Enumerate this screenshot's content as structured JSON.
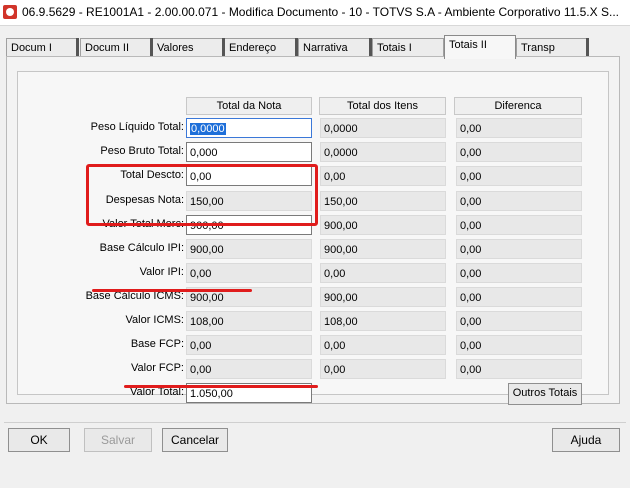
{
  "window": {
    "title": "06.9.5629 - RE1001A1 - 2.00.00.071 - Modifica Documento - 10 - TOTVS S.A - Ambiente Corporativo 11.5.X S..."
  },
  "tabs": [
    {
      "label": "Docum I"
    },
    {
      "label": "Docum II"
    },
    {
      "label": "Valores"
    },
    {
      "label": "Endereço"
    },
    {
      "label": "Narrativa"
    },
    {
      "label": "Totais I"
    },
    {
      "label": "Totais II"
    },
    {
      "label": "Transp"
    }
  ],
  "active_tab": "Totais II",
  "columns": [
    "Total da Nota",
    "Total dos Itens",
    "Diferenca"
  ],
  "rows": [
    {
      "label": "Peso Líquido Total:",
      "nota": "0,0000",
      "itens": "0,0000",
      "dif": "0,00"
    },
    {
      "label": "Peso Bruto Total:",
      "nota": "0,000",
      "itens": "0,0000",
      "dif": "0,00"
    },
    {
      "label": "Total Descto:",
      "nota": "0,00",
      "itens": "0,00",
      "dif": "0,00"
    },
    {
      "label": "Despesas Nota:",
      "nota": "150,00",
      "itens": "150,00",
      "dif": "0,00"
    },
    {
      "label": "Valor Total Merc:",
      "nota": "900,00",
      "itens": "900,00",
      "dif": "0,00"
    },
    {
      "label": "Base Cálculo IPI:",
      "nota": "900,00",
      "itens": "900,00",
      "dif": "0,00"
    },
    {
      "label": "Valor IPI:",
      "nota": "0,00",
      "itens": "0,00",
      "dif": "0,00"
    },
    {
      "label": "Base Cálculo ICMS:",
      "nota": "900,00",
      "itens": "900,00",
      "dif": "0,00"
    },
    {
      "label": "Valor ICMS:",
      "nota": "108,00",
      "itens": "108,00",
      "dif": "0,00"
    },
    {
      "label": "Base FCP:",
      "nota": "0,00",
      "itens": "0,00",
      "dif": "0,00"
    },
    {
      "label": "Valor FCP:",
      "nota": "0,00",
      "itens": "0,00",
      "dif": "0,00"
    },
    {
      "label": "Valor Total:",
      "nota": "1.050,00"
    }
  ],
  "buttons": {
    "outros_totais": "Outros Totais",
    "ok": "OK",
    "salvar": "Salvar",
    "cancelar": "Cancelar",
    "ajuda": "Ajuda"
  },
  "colors": {
    "highlight_red": "#e01c1c",
    "focus_blue": "#1e6fd9"
  }
}
